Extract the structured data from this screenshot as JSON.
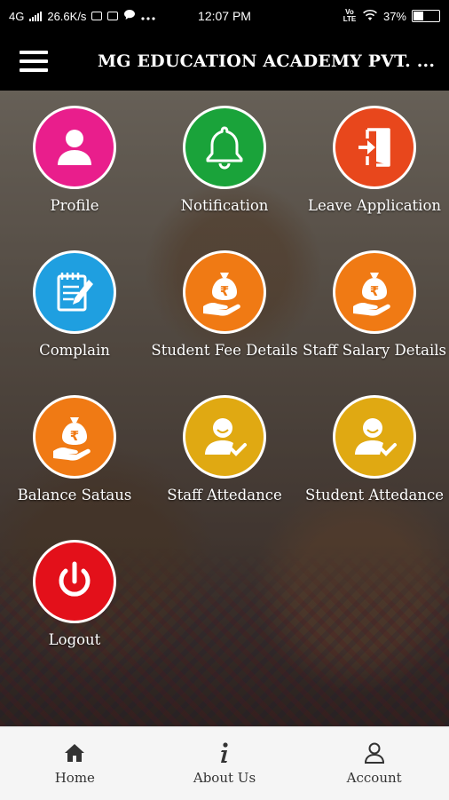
{
  "status_bar": {
    "network": "4G",
    "speed": "26.6K/s",
    "time": "12:07 PM",
    "volte": "Vo LTE",
    "battery": "37%",
    "battery_level": 0.37
  },
  "app_bar": {
    "title": "MG EDUCATION ACADEMY PVT. ..."
  },
  "tiles": [
    {
      "label": "Profile",
      "icon": "person-icon",
      "color": "#e91e8c"
    },
    {
      "label": "Notification",
      "icon": "bell-icon",
      "color": "#1aa33a"
    },
    {
      "label": "Leave Application",
      "icon": "exit-door-icon",
      "color": "#e8471c"
    },
    {
      "label": "Complain",
      "icon": "notepad-pen-icon",
      "color": "#1f9fe0"
    },
    {
      "label": "Student Fee Details",
      "icon": "rupee-bag-hand-icon",
      "color": "#f07a14"
    },
    {
      "label": "Staff Salary Details",
      "icon": "rupee-bag-hand-icon",
      "color": "#f07a14"
    },
    {
      "label": "Balance Sataus",
      "icon": "rupee-bag-hand-icon",
      "color": "#f07a14"
    },
    {
      "label": "Staff Attedance",
      "icon": "user-check-icon",
      "color": "#e0a912"
    },
    {
      "label": "Student Attedance",
      "icon": "user-check-icon",
      "color": "#e0a912"
    },
    {
      "label": "Logout",
      "icon": "power-icon",
      "color": "#e3101a"
    }
  ],
  "bottom_nav": [
    {
      "label": "Home",
      "icon": "home-icon"
    },
    {
      "label": "About Us",
      "icon": "info-icon"
    },
    {
      "label": "Account",
      "icon": "account-icon"
    }
  ]
}
